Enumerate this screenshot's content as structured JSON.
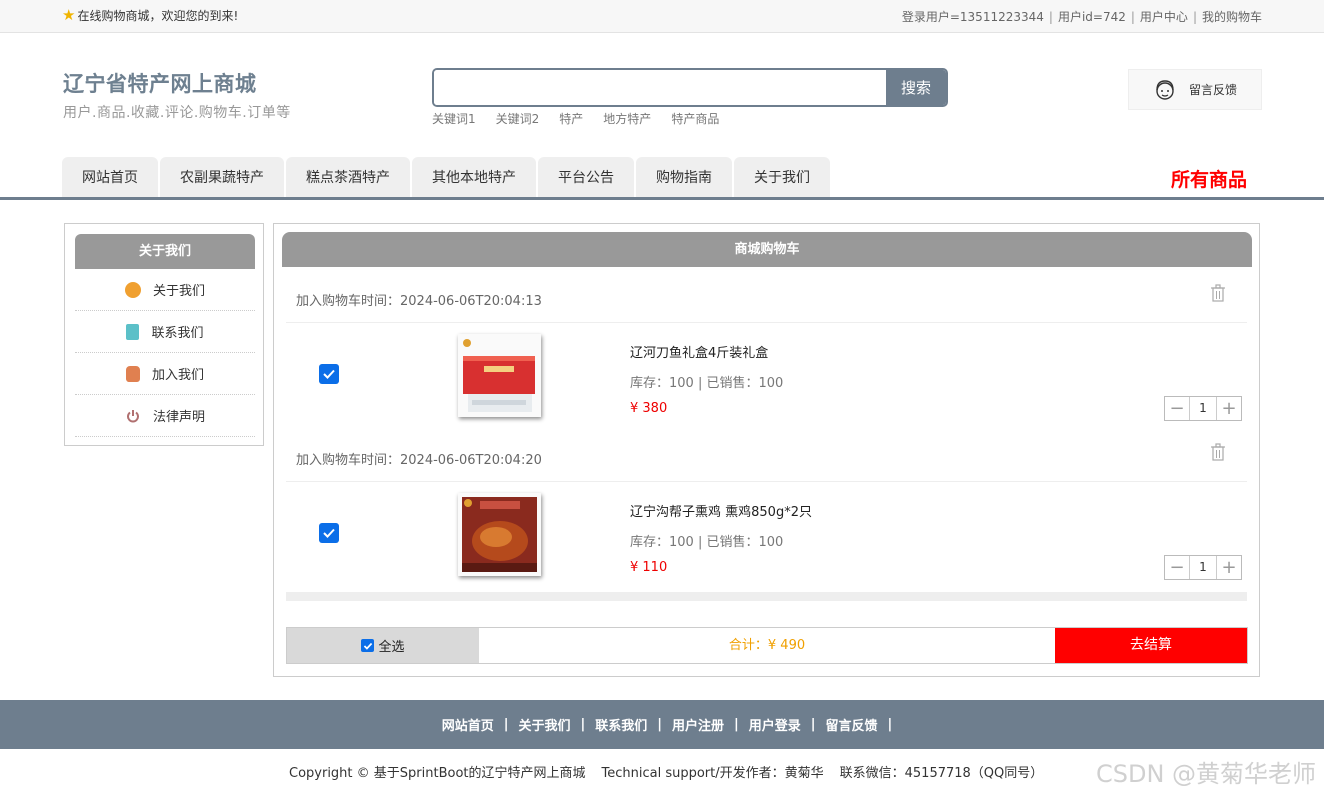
{
  "topbar": {
    "welcome": "在线购物商城，欢迎您的到来!",
    "user_text": "登录用户=13511223344",
    "userid_text": "用户id=742",
    "user_center": "用户中心",
    "my_cart": "我的购物车"
  },
  "brand": {
    "title": "辽宁省特产网上商城",
    "subtitle": "用户.商品.收藏.评论.购物车.订单等"
  },
  "search": {
    "placeholder": "",
    "button": "搜索",
    "keywords": [
      "关键词1",
      "关键词2",
      "特产",
      "地方特产",
      "特产商品"
    ]
  },
  "feedback_label": "留言反馈",
  "nav": {
    "tabs": [
      "网站首页",
      "农副果蔬特产",
      "糕点茶酒特产",
      "其他本地特产",
      "平台公告",
      "购物指南",
      "关于我们"
    ],
    "all_goods": "所有商品"
  },
  "sidebar": {
    "title": "关于我们",
    "items": [
      {
        "label": "关于我们",
        "icon": "orange-circle-icon",
        "color": "#f0a030"
      },
      {
        "label": "联系我们",
        "icon": "clipboard-icon",
        "color": "#5bc0c8"
      },
      {
        "label": "加入我们",
        "icon": "lock-icon",
        "color": "#e08050"
      },
      {
        "label": "法律声明",
        "icon": "power-icon",
        "color": "#b07070"
      }
    ]
  },
  "cart": {
    "title": "商城购物车",
    "items": [
      {
        "added": "加入购物车时间：2024-06-06T20:04:13",
        "name": "辽河刀鱼礼盒4斤装礼盒",
        "stock": "库存：100 | 已销售：100",
        "price": "¥ 380",
        "qty": "1",
        "checked": true
      },
      {
        "added": "加入购物车时间：2024-06-06T20:04:20",
        "name": "辽宁沟帮子熏鸡 熏鸡850g*2只",
        "stock": "库存：100 | 已销售：100",
        "price": "¥ 110",
        "qty": "1",
        "checked": true
      }
    ],
    "select_all": "全选",
    "total": "合计：¥ 490",
    "checkout": "去结算"
  },
  "footer": {
    "links": [
      "网站首页",
      "关于我们",
      "联系我们",
      "用户注册",
      "用户登录",
      "留言反馈"
    ],
    "copyright": "Copyright © 基于SprintBoot的辽宁特产网上商城",
    "support": "Technical support/开发作者：黄菊华",
    "contact": "联系微信：45157718（QQ同号）"
  },
  "watermark": "CSDN @黄菊华老师",
  "colors": {
    "accent": "#6e7e8e",
    "price": "#ee0000",
    "checkout": "#ff0000",
    "total": "#f0a000"
  }
}
